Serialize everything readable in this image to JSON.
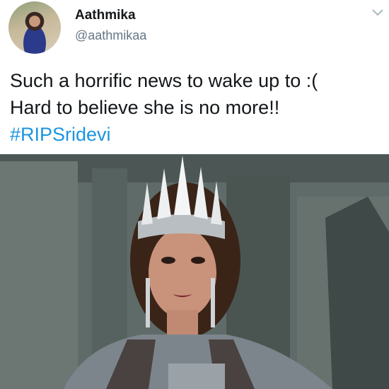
{
  "tweet": {
    "user": {
      "name": "Aathmika",
      "handle": "@aathmikaa"
    },
    "text_lines": [
      "Such a horrific news to wake up to :(",
      "Hard to believe she is no more!!"
    ],
    "hashtag": "#RIPSridevi",
    "menu_icon": "chevron-down-icon",
    "colors": {
      "text": "#14171a",
      "handle": "#657786",
      "hashtag": "#1b95e0"
    }
  }
}
